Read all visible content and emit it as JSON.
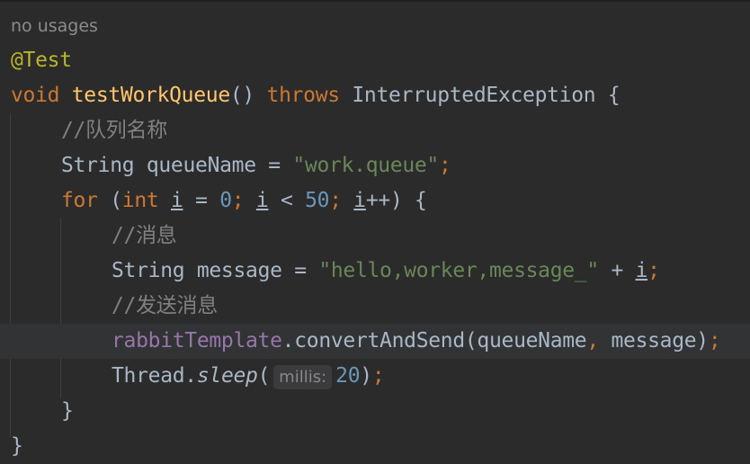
{
  "editor": {
    "usages_hint": "no usages",
    "highlighted_line": 9,
    "lines": [
      {
        "indent": 0,
        "tokens": [
          {
            "c": "an",
            "t": "@Test"
          }
        ]
      },
      {
        "indent": 0,
        "tokens": [
          {
            "c": "kw",
            "t": "void "
          },
          {
            "c": "fn",
            "t": "testWorkQueue"
          },
          {
            "c": "tx",
            "t": "() "
          },
          {
            "c": "kw",
            "t": "throws "
          },
          {
            "c": "tx",
            "t": "InterruptedException {"
          }
        ]
      },
      {
        "indent": 1,
        "tokens": [
          {
            "c": "cm",
            "t": "//队列名称"
          }
        ]
      },
      {
        "indent": 1,
        "tokens": [
          {
            "c": "tx",
            "t": "String queueName = "
          },
          {
            "c": "st",
            "t": "\"work.queue\""
          },
          {
            "c": "kw",
            "t": ";"
          }
        ]
      },
      {
        "indent": 1,
        "tokens": [
          {
            "c": "kw",
            "t": "for "
          },
          {
            "c": "tx",
            "t": "("
          },
          {
            "c": "kw",
            "t": "int "
          },
          {
            "c": "u",
            "t": "i"
          },
          {
            "c": "tx",
            "t": " = "
          },
          {
            "c": "nm",
            "t": "0"
          },
          {
            "c": "kw",
            "t": "; "
          },
          {
            "c": "u",
            "t": "i"
          },
          {
            "c": "tx",
            "t": " < "
          },
          {
            "c": "nm",
            "t": "50"
          },
          {
            "c": "kw",
            "t": "; "
          },
          {
            "c": "u",
            "t": "i"
          },
          {
            "c": "tx",
            "t": "++) {"
          }
        ]
      },
      {
        "indent": 2,
        "tokens": [
          {
            "c": "cm",
            "t": "//消息"
          }
        ]
      },
      {
        "indent": 2,
        "tokens": [
          {
            "c": "tx",
            "t": "String message = "
          },
          {
            "c": "st",
            "t": "\"hello,worker,message_\""
          },
          {
            "c": "tx",
            "t": " + "
          },
          {
            "c": "u",
            "t": "i"
          },
          {
            "c": "kw",
            "t": ";"
          }
        ]
      },
      {
        "indent": 2,
        "tokens": [
          {
            "c": "cm",
            "t": "//发送消息"
          }
        ]
      },
      {
        "indent": 2,
        "tokens": [
          {
            "c": "fd",
            "t": "rabbitTemplate"
          },
          {
            "c": "tx",
            "t": ".convertAndSend(queueName"
          },
          {
            "c": "kw",
            "t": ", "
          },
          {
            "c": "tx",
            "t": "message)"
          },
          {
            "c": "kw",
            "t": ";"
          }
        ]
      },
      {
        "indent": 2,
        "tokens": [
          {
            "c": "tx",
            "t": "Thread."
          },
          {
            "c": "it",
            "t": "sleep"
          },
          {
            "c": "tx",
            "t": "("
          },
          {
            "c": "inlay",
            "t": "millis:"
          },
          {
            "c": "nm",
            "t": "20"
          },
          {
            "c": "tx",
            "t": ")"
          },
          {
            "c": "kw",
            "t": ";"
          }
        ]
      },
      {
        "indent": 1,
        "tokens": [
          {
            "c": "tx",
            "t": "}"
          }
        ]
      },
      {
        "indent": 0,
        "tokens": [
          {
            "c": "tx",
            "t": "}"
          }
        ]
      }
    ]
  }
}
